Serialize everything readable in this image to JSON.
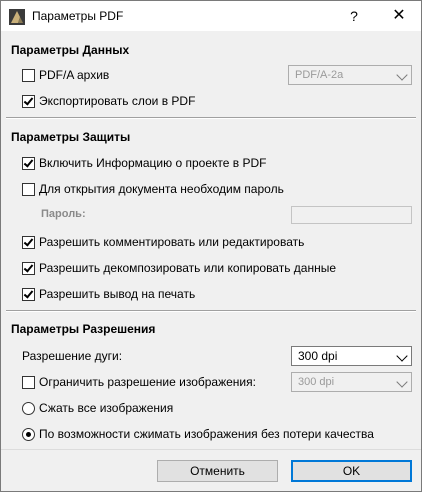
{
  "window": {
    "title": "Параметры PDF",
    "help_label": "?",
    "close_label": "✕"
  },
  "data_section": {
    "title": "Параметры Данных",
    "pdfa": {
      "label": "PDF/A архив",
      "checked": false,
      "select_value": "PDF/A-2a"
    },
    "export_layers": {
      "label": "Экспортировать слои в PDF",
      "checked": true
    }
  },
  "security_section": {
    "title": "Параметры Защиты",
    "project_info": {
      "label": "Включить Информацию о проекте в PDF",
      "checked": true
    },
    "password_required": {
      "label": "Для открытия документа необходим пароль",
      "checked": false
    },
    "password_label": "Пароль:",
    "allow_comment": {
      "label": "Разрешить комментировать или редактировать",
      "checked": true
    },
    "allow_decompose": {
      "label": "Разрешить декомпозировать или копировать данные",
      "checked": true
    },
    "allow_print": {
      "label": "Разрешить вывод на печать",
      "checked": true
    }
  },
  "resolution_section": {
    "title": "Параметры Разрешения",
    "arc_label": "Разрешение дуги:",
    "arc_value": "300 dpi",
    "limit_image": {
      "label": "Ограничить разрешение изображения:",
      "checked": false,
      "select_value": "300 dpi"
    },
    "compress_all": {
      "label": "Сжать все изображения",
      "selected": false
    },
    "compress_lossless": {
      "label": "По возможности сжимать изображения без потери качества",
      "selected": true
    }
  },
  "buttons": {
    "cancel": "Отменить",
    "ok": "OK"
  },
  "colors": {
    "accent": "#0078d7",
    "window_bg": "#f0f0f0"
  }
}
